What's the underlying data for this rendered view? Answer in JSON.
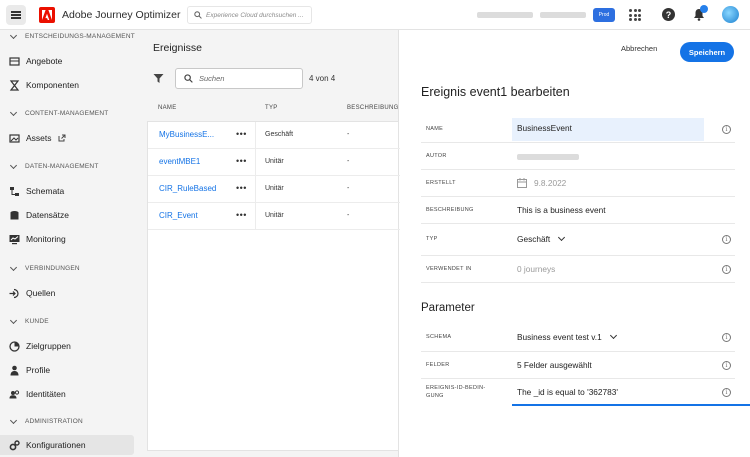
{
  "topbar": {
    "app_title": "Adobe Journey Optimizer",
    "search_placeholder": "Experience Cloud durchsuchen ...",
    "tag_label": "Prod"
  },
  "sidebar": {
    "sections": [
      {
        "label": "ENTSCHEIDUNGS-MANAGEMENT",
        "items": [
          {
            "label": "Angebote",
            "icon": "offers-icon"
          },
          {
            "label": "Komponenten",
            "icon": "components-icon"
          }
        ]
      },
      {
        "label": "CONTENT-MANAGEMENT",
        "items": [
          {
            "label": "Assets",
            "icon": "assets-icon",
            "external": true
          }
        ]
      },
      {
        "label": "DATEN-MANAGEMENT",
        "items": [
          {
            "label": "Schemata",
            "icon": "schema-icon"
          },
          {
            "label": "Datensätze",
            "icon": "datasets-icon"
          },
          {
            "label": "Monitoring",
            "icon": "monitoring-icon"
          }
        ]
      },
      {
        "label": "VERBINDUNGEN",
        "items": [
          {
            "label": "Quellen",
            "icon": "sources-icon"
          }
        ]
      },
      {
        "label": "KUNDE",
        "items": [
          {
            "label": "Zielgruppen",
            "icon": "audiences-icon"
          },
          {
            "label": "Profile",
            "icon": "profile-icon"
          },
          {
            "label": "Identitäten",
            "icon": "identities-icon"
          }
        ]
      },
      {
        "label": "ADMINISTRATION",
        "items": [
          {
            "label": "Konfigurationen",
            "icon": "configurations-icon",
            "active": true
          }
        ]
      }
    ]
  },
  "events_panel": {
    "title": "Ereignisse",
    "search_placeholder": "Suchen",
    "count": "4 von 4",
    "columns": [
      "NAME",
      "TYP",
      "BESCHREIBUNG"
    ],
    "rows": [
      {
        "name": "MyBusinessE...",
        "type": "Geschäft",
        "description": "-"
      },
      {
        "name": "eventMBE1",
        "type": "Unitär",
        "description": "-"
      },
      {
        "name": "CIR_RuleBased",
        "type": "Unitär",
        "description": "-"
      },
      {
        "name": "CIR_Event",
        "type": "Unitär",
        "description": "-"
      }
    ]
  },
  "editor": {
    "cancel_label": "Abbrechen",
    "save_label": "Speichern",
    "title": "Ereignis event1 bearbeiten",
    "fields": {
      "name_label": "NAME",
      "name_value": "BusinessEvent",
      "author_label": "AUTOR",
      "created_label": "ERSTELLT",
      "created_value": "9.8.2022",
      "description_label": "BESCHREIBUNG",
      "description_value": "This is a business event",
      "type_label": "TYP",
      "type_value": "Geschäft",
      "used_in_label": "VERWENDET IN",
      "used_in_value": "0 journeys"
    },
    "parameter_title": "Parameter",
    "parameters": {
      "schema_label": "SCHEMA",
      "schema_value": "Business event test v.1",
      "fields_label": "FELDER",
      "fields_value": "5 Felder ausgewählt",
      "condition_label_1": "EREIGNIS-ID-BEDIN-",
      "condition_label_2": "GUNG",
      "condition_value": "The _id is equal to '362783'"
    }
  },
  "colors": {
    "accent": "#1473e6",
    "adobe_red": "#eb1000",
    "sidebar_bg": "#f4f4f4"
  }
}
